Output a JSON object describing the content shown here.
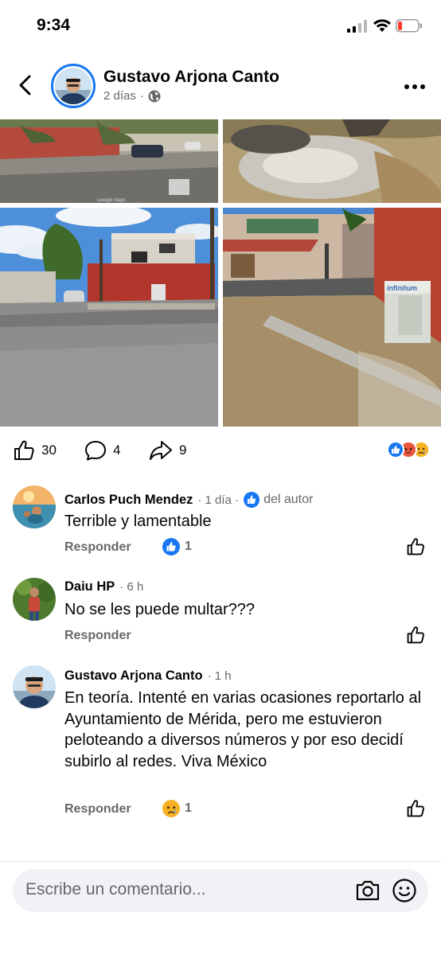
{
  "status_bar": {
    "time": "9:34",
    "battery_level": 0.15
  },
  "post": {
    "author": "Gustavo Arjona Canto",
    "time": "2 días",
    "privacy_icon": "globe-icon",
    "photo_watermark": "Google Maps"
  },
  "stats": {
    "likes": "30",
    "comments": "4",
    "shares": "9",
    "reactions": [
      "like",
      "angry",
      "sad"
    ]
  },
  "comments": [
    {
      "author": "Carlos Puch Mendez",
      "time": "· 1 día ·",
      "badge": "del autor",
      "text": "Terrible y lamentable",
      "reply_label": "Responder",
      "reaction": "like",
      "reaction_count": "1"
    },
    {
      "author": "Daiu HP",
      "time": "· 6 h",
      "text": "No se les puede multar???",
      "reply_label": "Responder"
    },
    {
      "author": "Gustavo Arjona Canto",
      "time": "· 1 h",
      "text": "En teoría. Intenté en varias ocasiones reportarlo al Ayuntamiento de Mérida, pero me estuvieron peloteando a diversos números y por eso decidí subirlo al redes. Viva México",
      "reply_label": "Responder",
      "reaction": "sad",
      "reaction_count": "1"
    }
  ],
  "composer": {
    "placeholder": "Escribe un comentario..."
  },
  "colors": {
    "accent": "#1877f2",
    "muted": "#65676b",
    "composer_bg": "#f0f2f5"
  }
}
